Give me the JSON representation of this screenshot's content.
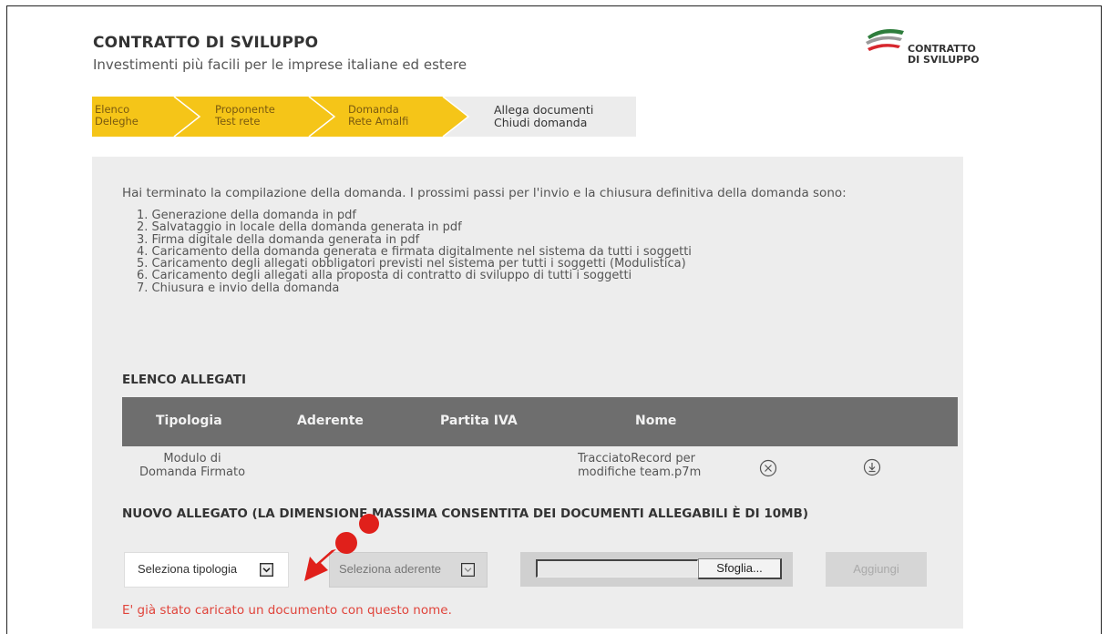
{
  "header": {
    "title": "CONTRATTO DI SVILUPPO",
    "subtitle": "Investimenti più facili per le imprese italiane ed estere",
    "logo_text_1": "CONTRATTO",
    "logo_text_2": "DI SVILUPPO"
  },
  "steps": [
    {
      "line1": "Elenco",
      "line2": "Deleghe"
    },
    {
      "line1": "Proponente",
      "line2": "Test rete"
    },
    {
      "line1": "Domanda",
      "line2": "Rete Amalfi"
    },
    {
      "line1": "Allega documenti",
      "line2": "Chiudi domanda"
    }
  ],
  "intro": "Hai terminato la compilazione della domanda. I prossimi passi per l'invio e la chiusura definitiva della domanda sono:",
  "next_steps": [
    "1. Generazione della domanda in pdf",
    "2. Salvataggio in locale della domanda generata in pdf",
    "3. Firma digitale della domanda generata in pdf",
    "4. Caricamento della domanda generata e firmata digitalmente nel sistema da tutti i soggetti",
    "5. Caricamento degli allegati obbligatori previsti nel sistema per tutti i soggetti (Modulistica)",
    "6. Caricamento degli allegati alla proposta di contratto di sviluppo di tutti i soggetti",
    "7. Chiusura e invio della domanda"
  ],
  "allegati": {
    "section_title": "ELENCO ALLEGATI",
    "columns": [
      "Tipologia",
      "Aderente",
      "Partita IVA",
      "Nome"
    ],
    "rows": [
      {
        "tipologia_1": "Modulo di",
        "tipologia_2": "Domanda Firmato",
        "aderente": "",
        "partita_iva": "",
        "nome_1": "TracciatoRecord per",
        "nome_2": "modifiche team.p7m"
      }
    ]
  },
  "nuovo_allegato": {
    "title": "NUOVO ALLEGATO (LA DIMENSIONE MASSIMA CONSENTITA DEI DOCUMENTI ALLEGABILI È DI 10MB)",
    "tipologia_select": "Seleziona tipologia",
    "aderente_select": "Seleziona aderente",
    "browse_label": "Sfoglia...",
    "add_label": "Aggiungi",
    "error": "E' già stato caricato un documento con questo nome."
  },
  "colors": {
    "step_active": "#f5c518",
    "step_inactive": "#ececec",
    "table_header": "#6e6e6e",
    "error": "#e0443b",
    "annotation_arrow": "#e0201b"
  }
}
